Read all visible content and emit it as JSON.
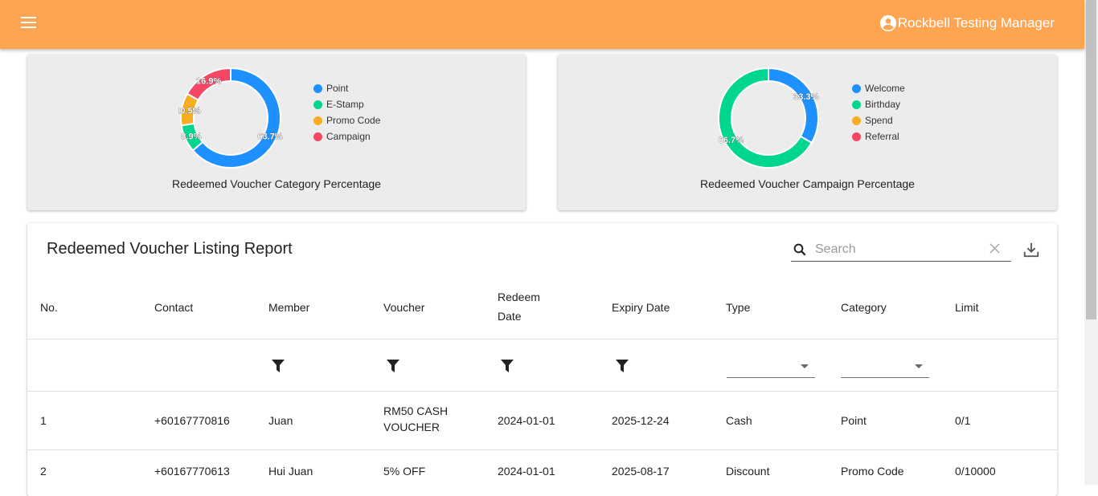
{
  "header": {
    "menu_icon": "menu-icon",
    "user_icon": "account-circle-icon",
    "user_name": "Rockbell Testing Manager",
    "color": "#ffa552"
  },
  "charts": {
    "category": {
      "title": "Redeemed Voucher Category Percentage",
      "legend": [
        "Point",
        "E-Stamp",
        "Promo Code",
        "Campaign"
      ],
      "labels": [
        "63.7%",
        "8.9%",
        "10.5%",
        "16.9%"
      ]
    },
    "campaign": {
      "title": "Redeemed Voucher Campaign Percentage",
      "legend": [
        "Welcome",
        "Birthday",
        "Spend",
        "Referral"
      ],
      "labels": [
        "33.3%",
        "66.7%"
      ]
    }
  },
  "report": {
    "title": "Redeemed Voucher Listing Report",
    "search_placeholder": "Search",
    "columns": [
      "No.",
      "Contact",
      "Member",
      "Voucher",
      "Redeem Date",
      "Expiry Date",
      "Type",
      "Category",
      "Limit"
    ],
    "rows": [
      [
        "1",
        "+60167770816",
        "Juan",
        "RM50 CASH VOUCHER",
        "2024-01-01",
        "2025-12-24",
        "Cash",
        "Point",
        "0/1"
      ],
      [
        "2",
        "+60167770613",
        "Hui Juan",
        "5% OFF",
        "2024-01-01",
        "2025-08-17",
        "Discount",
        "Promo Code",
        "0/10000"
      ]
    ]
  },
  "chart_data": [
    {
      "type": "pie",
      "title": "Redeemed Voucher Category Percentage",
      "categories": [
        "Point",
        "E-Stamp",
        "Promo Code",
        "Campaign"
      ],
      "values": [
        63.7,
        8.9,
        10.5,
        16.9
      ],
      "colors": [
        "#1e90ff",
        "#00d68f",
        "#f9ad20",
        "#f54664"
      ],
      "legend": "right"
    },
    {
      "type": "pie",
      "title": "Redeemed Voucher Campaign Percentage",
      "categories": [
        "Welcome",
        "Birthday",
        "Spend",
        "Referral"
      ],
      "values": [
        33.3,
        66.7,
        0,
        0
      ],
      "colors": [
        "#1e90ff",
        "#00d68f",
        "#f9ad20",
        "#f54664"
      ],
      "legend": "right"
    }
  ]
}
